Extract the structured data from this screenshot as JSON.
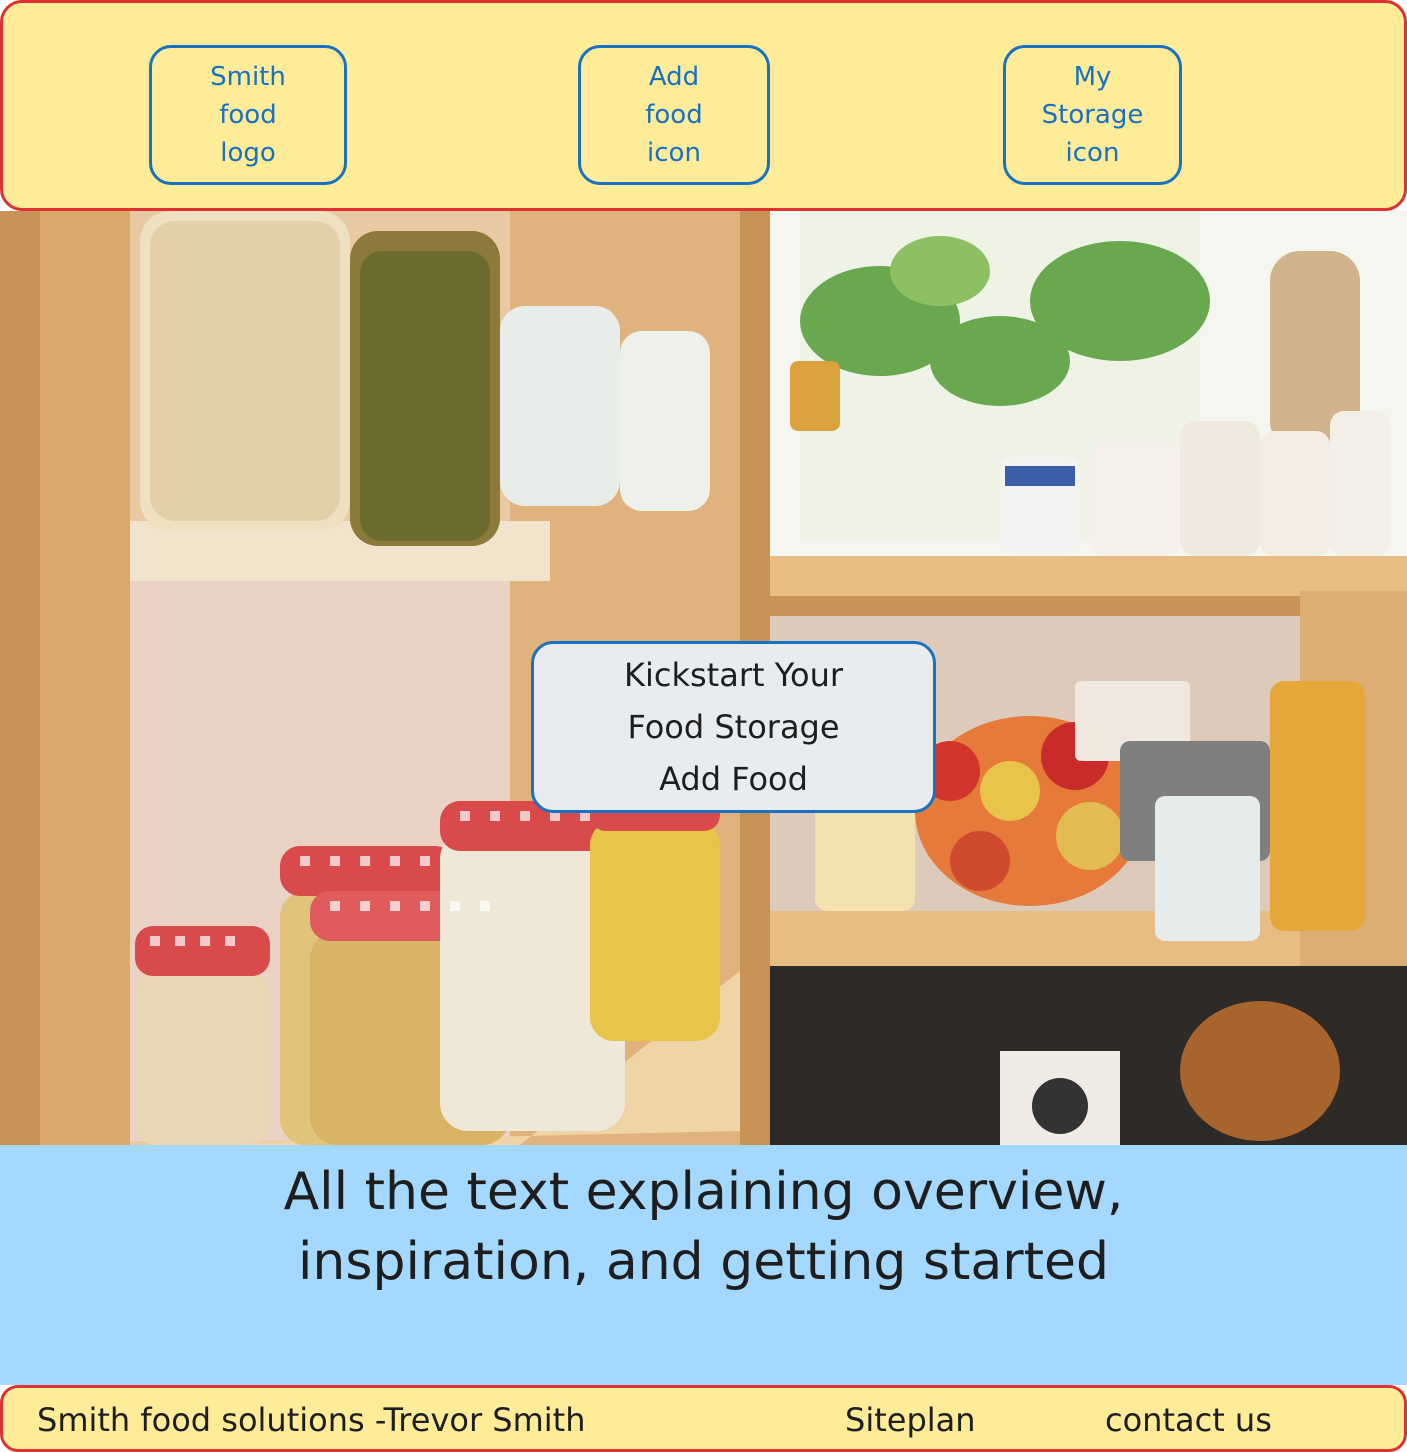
{
  "header": {
    "logo_label": "Smith\nfood\nlogo",
    "add_food_label": "Add\nfood\nicon",
    "my_storage_label": "My\nStorage\nicon"
  },
  "hero": {
    "cta_label": "Kickstart Your\nFood Storage\nAdd Food"
  },
  "overview": {
    "text": "All the text explaining overview,\ninspiration, and getting started"
  },
  "footer": {
    "brand": "Smith food solutions -Trevor Smith",
    "siteplan": "Siteplan",
    "contact": "contact us"
  },
  "colors": {
    "header_bg": "#ffec99",
    "header_border": "#e03131",
    "nav_border": "#1971c2",
    "overview_bg": "#a5d8ff",
    "cta_bg": "#e9ecef"
  },
  "icons": [
    "pantry-photo"
  ]
}
